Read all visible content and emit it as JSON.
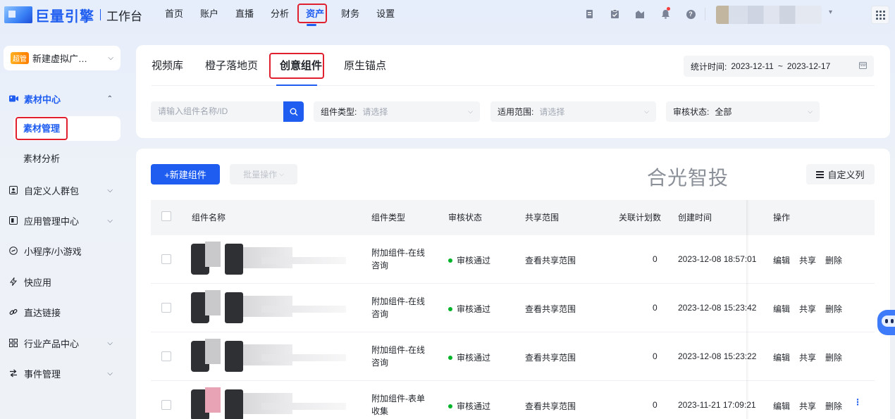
{
  "header": {
    "brand": "巨量引擎",
    "product": "工作台",
    "nav": [
      "首页",
      "账户",
      "直播",
      "分析",
      "资产",
      "财务",
      "设置"
    ],
    "nav_active": "资产",
    "icons": [
      "doc-icon",
      "clipboard-icon",
      "chart-icon",
      "bell-icon",
      "help-icon"
    ],
    "help_glyph": "?"
  },
  "sidebar": {
    "badge": "超管",
    "account_name": "新建虚拟广…",
    "sections": [
      {
        "label": "素材中心",
        "icon": "video-icon",
        "expanded": true
      },
      {
        "label": "素材管理"
      },
      {
        "label": "素材分析"
      },
      {
        "label": "自定义人群包",
        "icon": "audience-icon"
      },
      {
        "label": "应用管理中心",
        "icon": "app-icon"
      },
      {
        "label": "小程序/小游戏",
        "icon": "miniprogram-icon"
      },
      {
        "label": "快应用",
        "icon": "quickapp-icon"
      },
      {
        "label": "直达链接",
        "icon": "link-icon"
      },
      {
        "label": "行业产品中心",
        "icon": "grid-icon"
      },
      {
        "label": "事件管理",
        "icon": "event-icon"
      }
    ]
  },
  "tabs": [
    "视频库",
    "橙子落地页",
    "创意组件",
    "原生锚点"
  ],
  "active_tab": "创意组件",
  "date_range": {
    "label": "统计时间:",
    "start": "2023-12-11",
    "separator": "~",
    "end": "2023-12-17"
  },
  "filters": {
    "search_placeholder": "请输入组件名称/ID",
    "component_type": {
      "label": "组件类型:",
      "value": "请选择"
    },
    "scope": {
      "label": "适用范围:",
      "value": "请选择"
    },
    "review_status": {
      "label": "审核状态:",
      "value": "全部"
    }
  },
  "toolbar": {
    "new_button": "+新建组件",
    "batch_button": "批量操作",
    "watermark_text": "合光智投",
    "custom_columns": "自定义列"
  },
  "table": {
    "columns": [
      "组件名称",
      "组件类型",
      "审核状态",
      "共享范围",
      "关联计划数",
      "创建时间",
      "操作"
    ],
    "rows": [
      {
        "type": "附加组件-在线咨询",
        "status": "审核通过",
        "share": "查看共享范围",
        "plans": "0",
        "created": "2023-12-08 18:57:01"
      },
      {
        "type": "附加组件-在线咨询",
        "status": "审核通过",
        "share": "查看共享范围",
        "plans": "0",
        "created": "2023-12-08 15:23:42"
      },
      {
        "type": "附加组件-在线咨询",
        "status": "审核通过",
        "share": "查看共享范围",
        "plans": "0",
        "created": "2023-12-08 15:23:22"
      },
      {
        "type": "附加组件-表单收集",
        "status": "审核通过",
        "share": "查看共享范围",
        "plans": "0",
        "created": "2023-11-21 17:09:21"
      }
    ],
    "actions": [
      "编辑",
      "共享",
      "删除"
    ]
  },
  "colors": {
    "primary": "#1e5df0",
    "highlight": "#e0202e",
    "success": "#00b42a"
  }
}
